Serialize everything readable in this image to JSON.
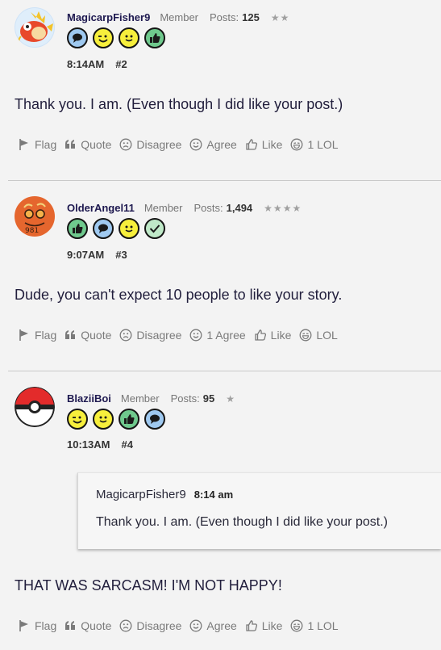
{
  "colors": {
    "background": "#f3f3f3",
    "username": "#1e1950",
    "muted": "#7a7a7a",
    "divider": "#c9c9c9"
  },
  "posts": [
    {
      "username": "MagicarpFisher9",
      "role": "Member",
      "posts_label": "Posts:",
      "posts_count": "125",
      "stars": "★★",
      "avatar": "magikarp-avatar",
      "badges": [
        "speech-bubble-icon",
        "wink-icon",
        "smile-icon",
        "thumbs-up-icon"
      ],
      "time": "8:14AM",
      "number": "#2",
      "message": "Thank you. I am. (Even though I did like your post.)",
      "actions": {
        "flag": "Flag",
        "quote": "Quote",
        "disagree": "Disagree",
        "agree": "Agree",
        "like": "Like",
        "lol": "1 LOL"
      }
    },
    {
      "username": "OlderAngel11",
      "role": "Member",
      "posts_label": "Posts:",
      "posts_count": "1,494",
      "stars": "★★★★",
      "avatar": "orange-doodle-avatar",
      "badges": [
        "thumbs-up-icon",
        "speech-bubble-icon",
        "smile-icon",
        "checkmark-icon"
      ],
      "time": "9:07AM",
      "number": "#3",
      "message": "Dude, you can't expect 10 people to like your story.",
      "actions": {
        "flag": "Flag",
        "quote": "Quote",
        "disagree": "Disagree",
        "agree": "1 Agree",
        "like": "Like",
        "lol": "LOL"
      }
    },
    {
      "username": "BlaziiBoi",
      "role": "Member",
      "posts_label": "Posts:",
      "posts_count": "95",
      "stars": "★",
      "avatar": "pokeball-avatar",
      "badges": [
        "wink-icon",
        "smile-icon",
        "thumbs-up-icon",
        "speech-bubble-icon"
      ],
      "time": "10:13AM",
      "number": "#4",
      "quote": {
        "author": "MagicarpFisher9",
        "time": "8:14 am",
        "text": "Thank you. I am. (Even though I did like your post.)"
      },
      "message": "THAT WAS SARCASM! I'M NOT HAPPY!",
      "actions": {
        "flag": "Flag",
        "quote": "Quote",
        "disagree": "Disagree",
        "agree": "Agree",
        "like": "Like",
        "lol": "1 LOL"
      }
    }
  ]
}
